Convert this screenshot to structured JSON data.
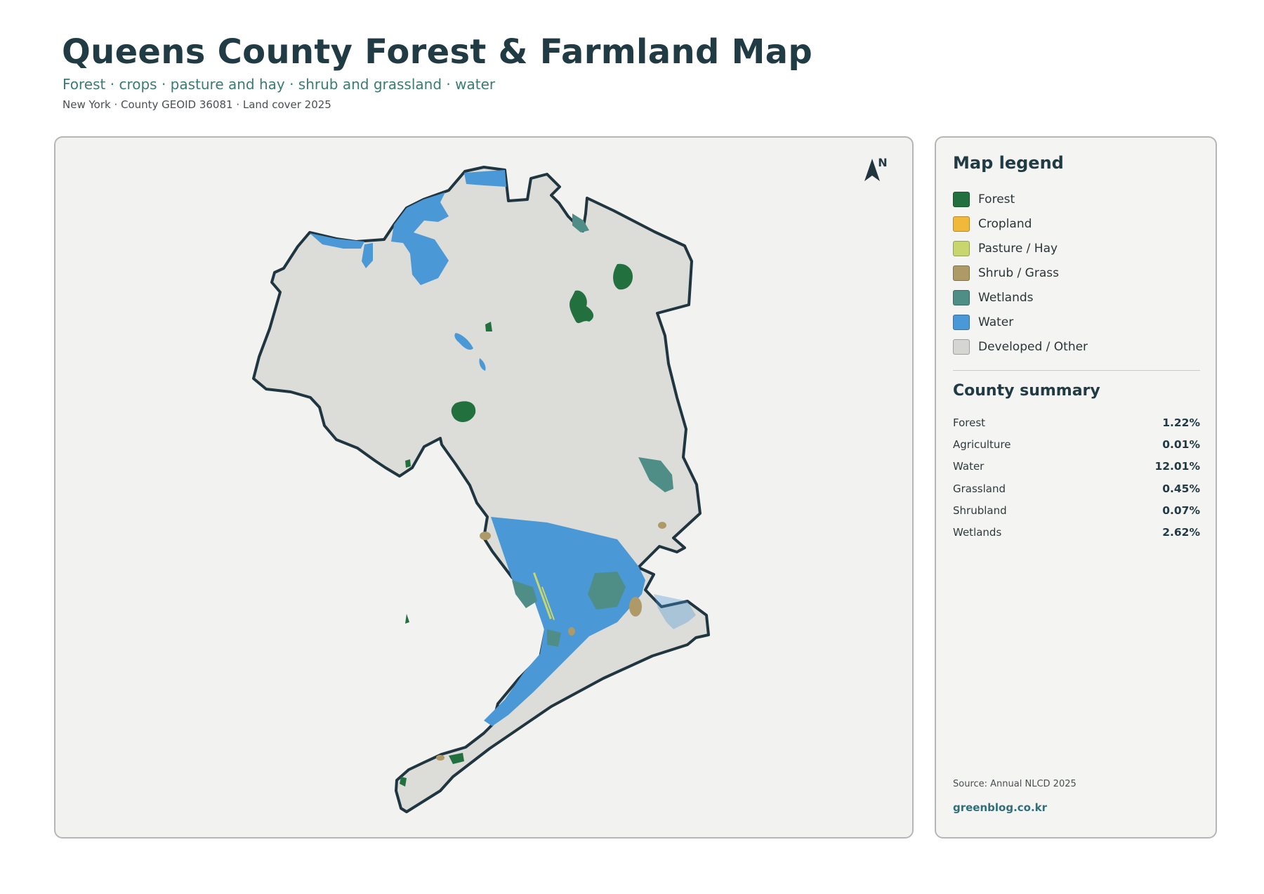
{
  "header": {
    "title": "Queens County Forest & Farmland Map",
    "subtitle": "Forest · crops · pasture and hay · shrub and grassland · water",
    "meta": "New York · County GEOID 36081 · Land cover 2025"
  },
  "map": {
    "north_label": "N",
    "colors": {
      "background": "#f2f2f0",
      "county_fill": "#dcdcd8",
      "county_outline": "#1f3540",
      "forest": "#23703f",
      "water": "#4a98d6",
      "wetlands": "#4f8e87",
      "shrub": "#ad9a66",
      "pasture": "#c7d66d"
    }
  },
  "legend": {
    "title": "Map legend",
    "items": [
      {
        "label": "Forest",
        "color": "#23703f"
      },
      {
        "label": "Cropland",
        "color": "#f0b93a"
      },
      {
        "label": "Pasture / Hay",
        "color": "#c9d66e"
      },
      {
        "label": "Shrub / Grass",
        "color": "#ad9a66"
      },
      {
        "label": "Wetlands",
        "color": "#4f8e87"
      },
      {
        "label": "Water",
        "color": "#4a98d6"
      },
      {
        "label": "Developed / Other",
        "color": "#d5d5d2"
      }
    ]
  },
  "summary": {
    "title": "County summary",
    "rows": [
      {
        "name": "Forest",
        "value": "1.22%"
      },
      {
        "name": "Agriculture",
        "value": "0.01%"
      },
      {
        "name": "Water",
        "value": "12.01%"
      },
      {
        "name": "Grassland",
        "value": "0.45%"
      },
      {
        "name": "Shrubland",
        "value": "0.07%"
      },
      {
        "name": "Wetlands",
        "value": "2.62%"
      }
    ]
  },
  "footer": {
    "source": "Source: Annual NLCD 2025",
    "brand": "greenblog.co.kr"
  }
}
